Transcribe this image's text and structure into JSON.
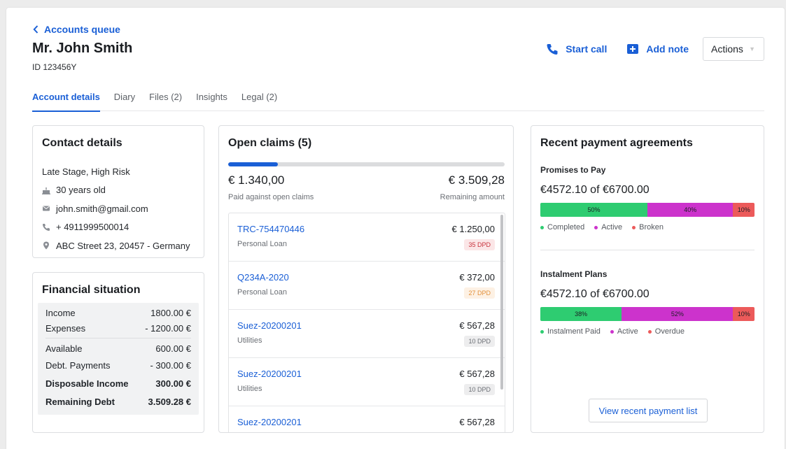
{
  "header": {
    "back_label": "Accounts queue",
    "customer_name": "Mr. John Smith",
    "customer_id": "ID 123456Y",
    "start_call_label": "Start call",
    "add_note_label": "Add note",
    "actions_label": "Actions"
  },
  "tabs": [
    {
      "label": "Account details",
      "active": true
    },
    {
      "label": "Diary"
    },
    {
      "label": "Files (2)"
    },
    {
      "label": "Insights"
    },
    {
      "label": "Legal (2)"
    }
  ],
  "contact": {
    "title": "Contact details",
    "segment": "Late Stage, High Risk",
    "age": "30 years old",
    "email": "john.smith@gmail.com",
    "phone": "+ 4911999500014",
    "address": "ABC Street 23, 20457 - Germany"
  },
  "financial": {
    "title": "Financial situation",
    "rows": [
      {
        "label": "Income",
        "value": "1800.00 €"
      },
      {
        "label": "Expenses",
        "value": "- 1200.00 €"
      },
      {
        "label": "Available",
        "value": "600.00 €"
      },
      {
        "label": "Debt. Payments",
        "value": "- 300.00 €"
      },
      {
        "label": "Disposable Income",
        "value": "300.00 €"
      },
      {
        "label": "Remaining Debt",
        "value": "3.509.28 €"
      }
    ]
  },
  "claims": {
    "title": "Open claims (5)",
    "paid": "€ 1.340,00",
    "paid_label": "Paid against open claims",
    "remaining": "€ 3.509,28",
    "remaining_label": "Remaining amount",
    "progress": 0.18,
    "items": [
      {
        "ref": "TRC-754470446",
        "type": "Personal Loan",
        "amount": "€ 1.250,00",
        "dpd": "35 DPD",
        "dpd_color": "#c8323c",
        "dpd_bg": "#fbe6e7"
      },
      {
        "ref": "Q234A-2020",
        "type": "Personal Loan",
        "amount": "€ 372,00",
        "dpd": "27 DPD",
        "dpd_color": "#e3913c",
        "dpd_bg": "#fdf1e4"
      },
      {
        "ref": "Suez-20200201",
        "type": "Utilities",
        "amount": "€ 567,28",
        "dpd": "10 DPD",
        "dpd_color": "#6b6f75",
        "dpd_bg": "#ededee"
      },
      {
        "ref": "Suez-20200201",
        "type": "Utilities",
        "amount": "€ 567,28",
        "dpd": "10 DPD",
        "dpd_color": "#6b6f75",
        "dpd_bg": "#ededee"
      },
      {
        "ref": "Suez-20200201",
        "type": "",
        "amount": "€ 567,28",
        "dpd": "",
        "dpd_color": "#6b6f75",
        "dpd_bg": "#ededee"
      }
    ]
  },
  "agreements": {
    "title": "Recent payment agreements",
    "promises": {
      "label": "Promises to Pay",
      "amount": "€4572.10 of €6700.00",
      "segments": [
        {
          "label": "50%",
          "value": 50,
          "color": "#2ecc71"
        },
        {
          "label": "40%",
          "value": 40,
          "color": "#cc33cc"
        },
        {
          "label": "10%",
          "value": 10,
          "color": "#ec5a5a"
        }
      ],
      "legend": [
        {
          "label": "Completed",
          "color": "#2ecc71"
        },
        {
          "label": "Active",
          "color": "#cc33cc"
        },
        {
          "label": "Broken",
          "color": "#ec5a5a"
        }
      ]
    },
    "plans": {
      "label": "Instalment Plans",
      "amount": "€4572.10 of €6700.00",
      "segments": [
        {
          "label": "38%",
          "value": 38,
          "color": "#2ecc71"
        },
        {
          "label": "52%",
          "value": 52,
          "color": "#cc33cc"
        },
        {
          "label": "10%",
          "value": 10,
          "color": "#ec5a5a"
        }
      ],
      "legend": [
        {
          "label": "Instalment Paid",
          "color": "#2ecc71"
        },
        {
          "label": "Active",
          "color": "#cc33cc"
        },
        {
          "label": "Overdue",
          "color": "#ec5a5a"
        }
      ]
    },
    "view_button": "View recent payment list"
  }
}
